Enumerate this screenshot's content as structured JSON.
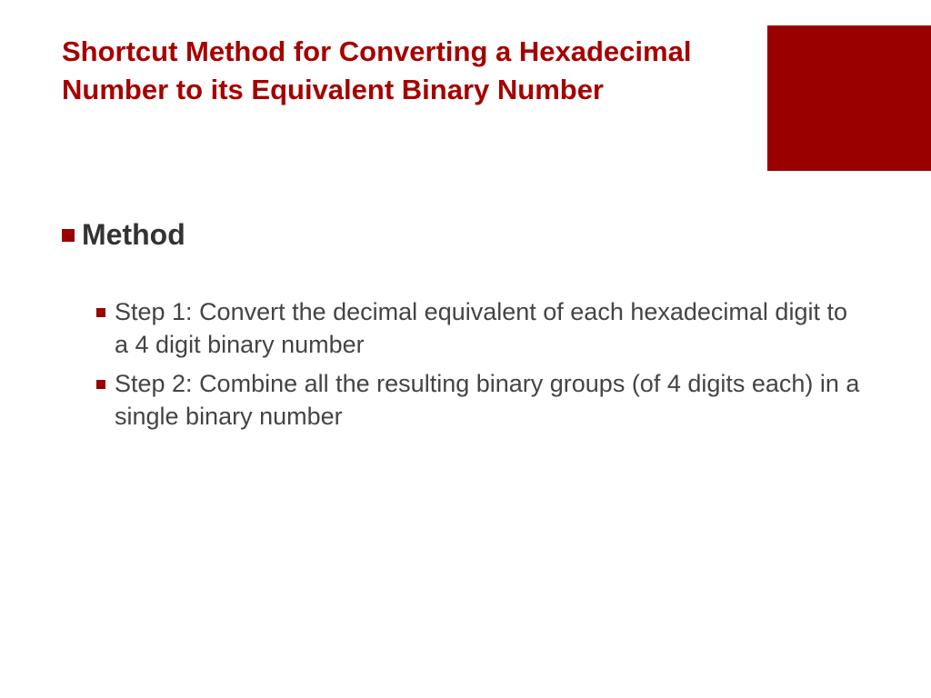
{
  "title": "Shortcut Method for Converting a Hexadecimal Number to its Equivalent Binary Number",
  "section_heading": "Method",
  "steps": {
    "0": "Step 1: Convert the decimal equivalent of each hexadecimal digit to a 4 digit binary number",
    "1": "Step 2: Combine all the resulting binary groups (of 4 digits each) in a single binary number"
  }
}
